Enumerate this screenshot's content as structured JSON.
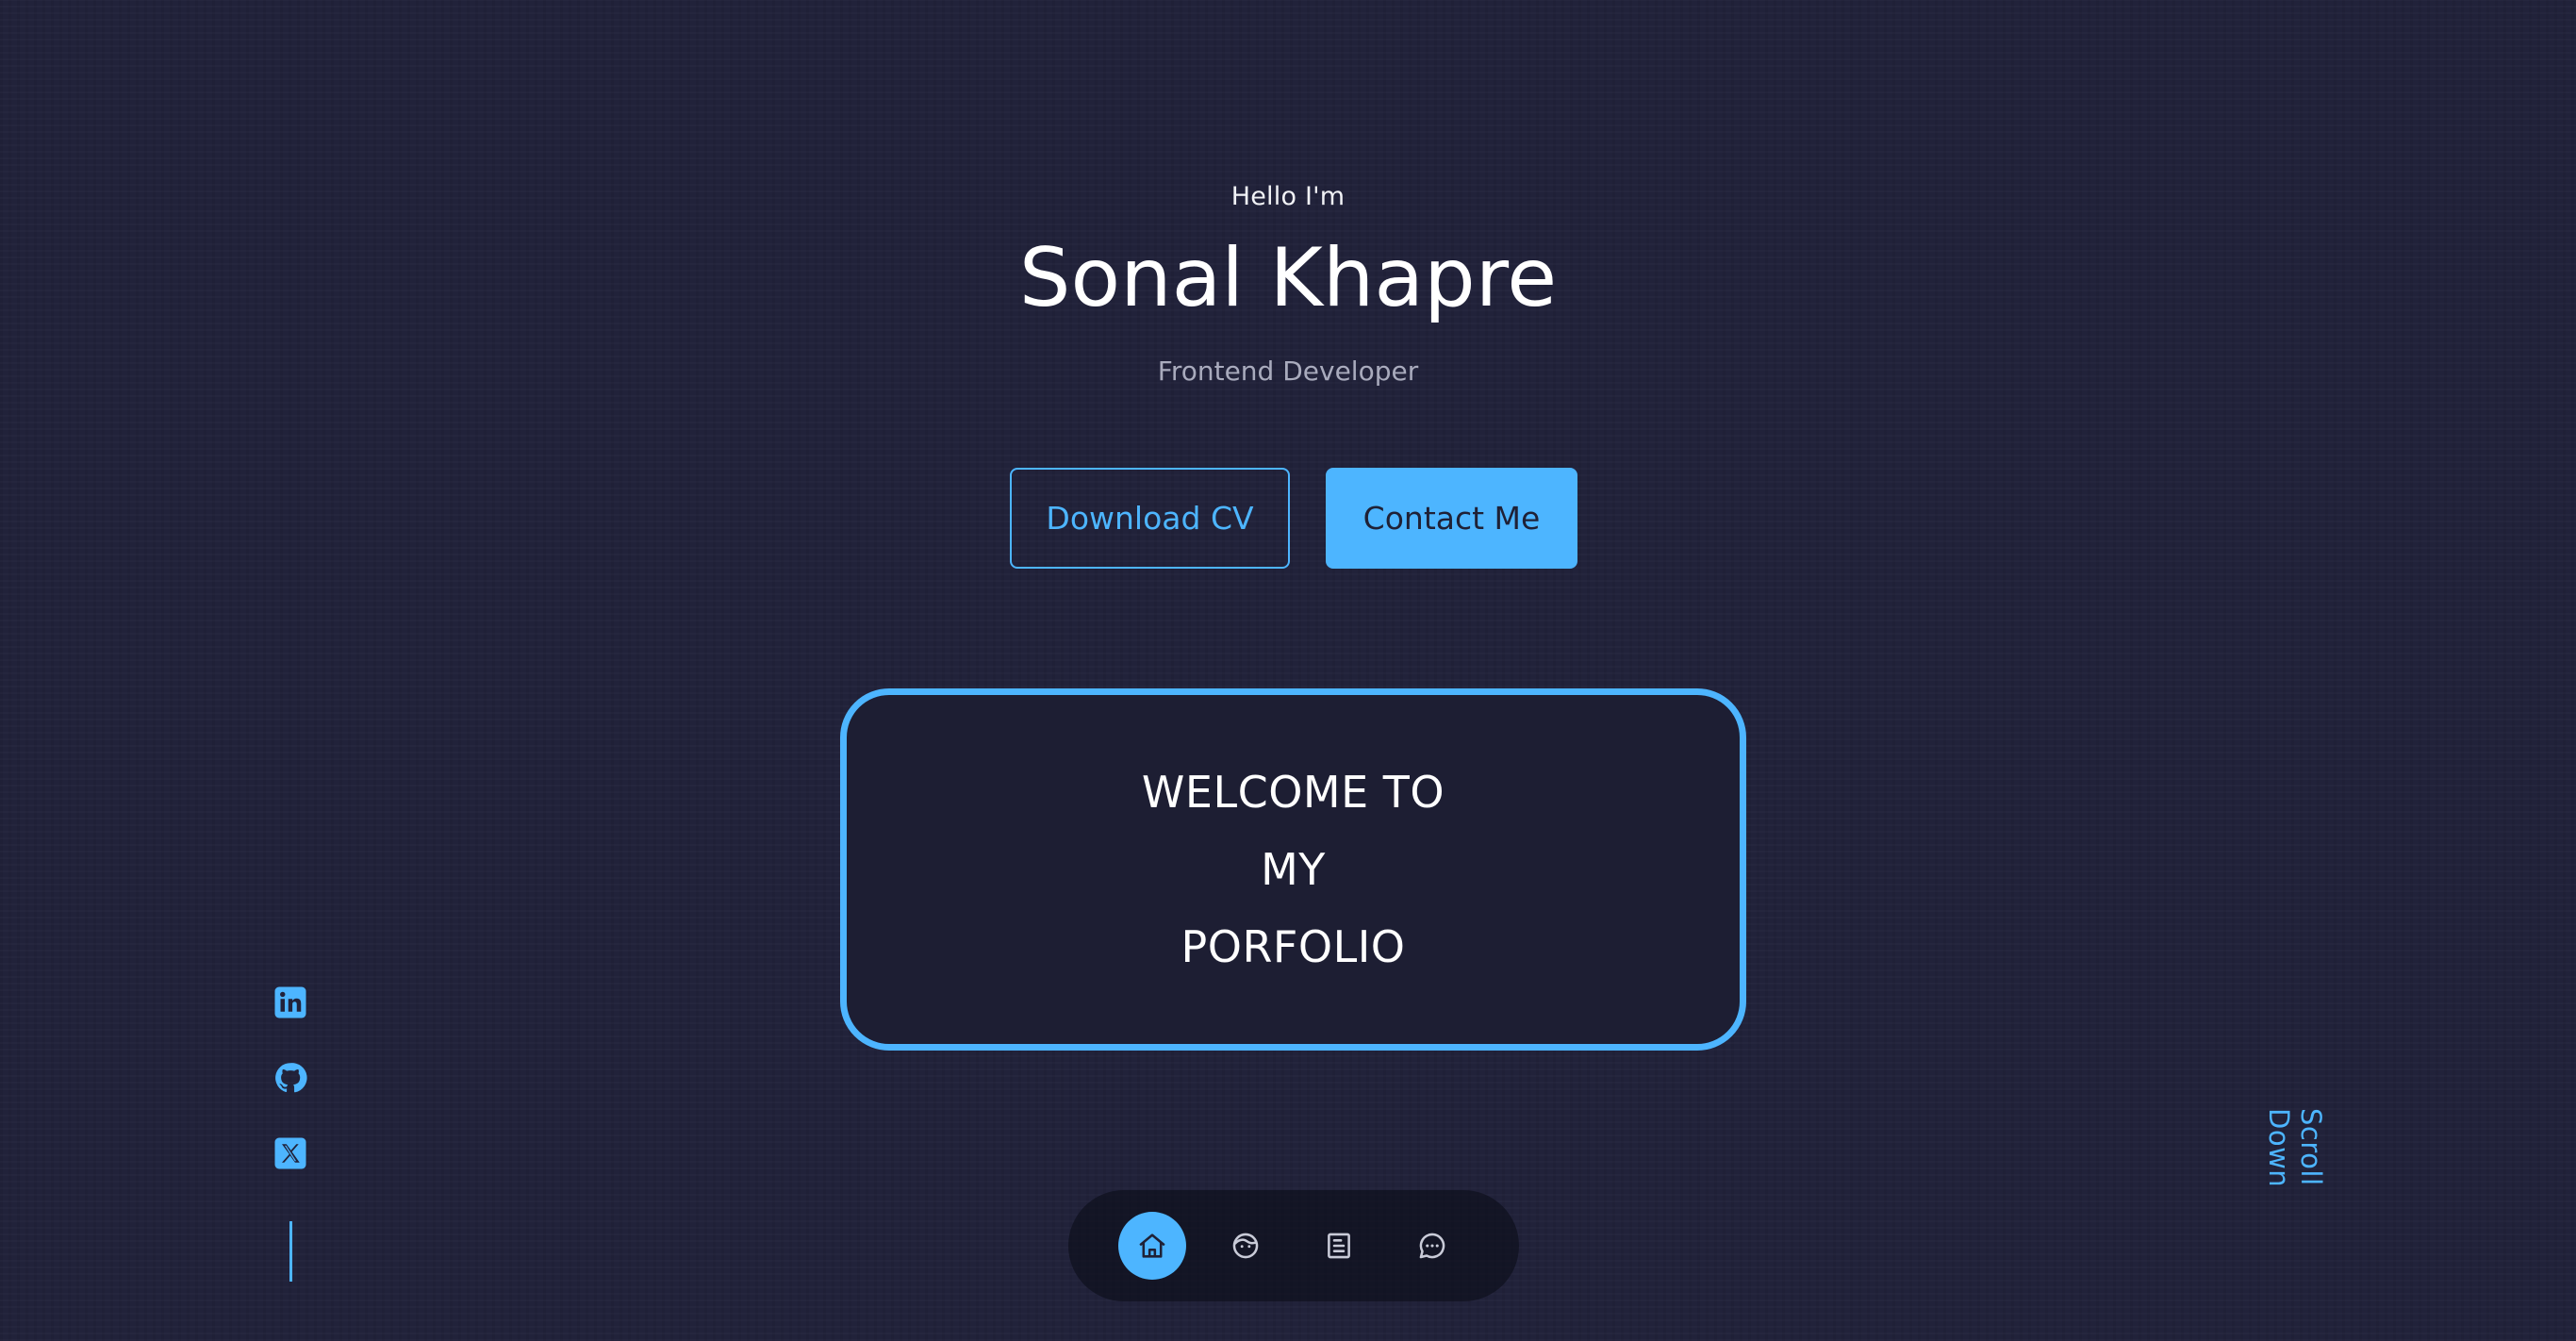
{
  "hero": {
    "greeting": "Hello I'm",
    "name": "Sonal Khapre",
    "role": "Frontend Developer"
  },
  "buttons": {
    "download_cv": "Download CV",
    "contact_me": "Contact Me"
  },
  "welcome_card": {
    "lines": [
      "WELCOME TO",
      "MY",
      "PORFOLIO"
    ]
  },
  "socials": [
    {
      "icon": "linkedin-icon"
    },
    {
      "icon": "github-icon"
    },
    {
      "icon": "x-twitter-icon"
    }
  ],
  "scroll_down": "Scroll Down",
  "nav": {
    "items": [
      {
        "icon": "home-icon",
        "active": true
      },
      {
        "icon": "user-face-icon",
        "active": false
      },
      {
        "icon": "document-icon",
        "active": false
      },
      {
        "icon": "chat-icon",
        "active": false
      }
    ]
  },
  "colors": {
    "background": "#21223a",
    "accent": "#4db5ff",
    "card_bg": "#1d1e33",
    "muted_text": "#a9abbd",
    "nav_bg": "#14152a"
  }
}
